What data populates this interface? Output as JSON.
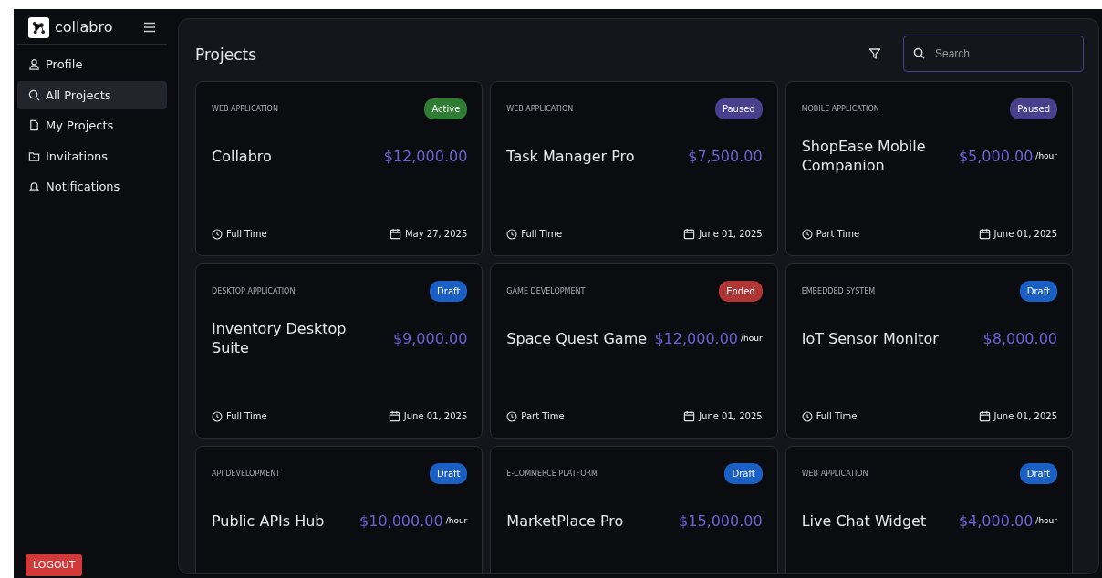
{
  "brand": {
    "name": "collabro"
  },
  "sidebar": {
    "items": [
      {
        "label": "Profile",
        "selected": false
      },
      {
        "label": "All Projects",
        "selected": true
      },
      {
        "label": "My Projects",
        "selected": false
      },
      {
        "label": "Invitations",
        "selected": false
      },
      {
        "label": "Notifications",
        "selected": false
      }
    ],
    "logout": "LOGOUT"
  },
  "header": {
    "title": "Projects",
    "search": {
      "placeholder": "Search"
    }
  },
  "projects": [
    {
      "category": "WEB APPLICATION",
      "status": "Active",
      "color": "#2e7d32",
      "name": "Collabro",
      "price": "$12,000.00",
      "type": "Full Time",
      "date": "May 27, 2025"
    },
    {
      "category": "WEB APPLICATION",
      "status": "Paused",
      "color": "#4a3f8c",
      "name": "Task Manager Pro",
      "price": "$7,500.00",
      "type": "Full Time",
      "date": "June 01, 2025"
    },
    {
      "category": "MOBILE APPLICATION",
      "status": "Paused",
      "color": "#4a3f8c",
      "name": "ShopEase Mobile Companion",
      "price": "$5,000.00",
      "unit": "/hour",
      "type": "Part Time",
      "date": "June 01, 2025"
    },
    {
      "category": "DESKTOP APPLICATION",
      "status": "Draft",
      "color": "#1a5fc4",
      "name": "Inventory Desktop Suite",
      "price": "$9,000.00",
      "type": "Full Time",
      "date": "June 01, 2025"
    },
    {
      "category": "GAME DEVELOPMENT",
      "status": "Ended",
      "color": "#b03535",
      "name": "Space Quest Game",
      "price": "$12,000.00",
      "unit": "/hour",
      "type": "Part Time",
      "date": "June 01, 2025"
    },
    {
      "category": "EMBEDDED SYSTEM",
      "status": "Draft",
      "color": "#1a5fc4",
      "name": "IoT Sensor Monitor",
      "price": "$8,000.00",
      "type": "Full Time",
      "date": "June 01, 2025"
    },
    {
      "category": "API DEVELOPMENT",
      "status": "Draft",
      "color": "#1a5fc4",
      "name": "Public APIs Hub",
      "price": "$10,000.00",
      "unit": "/hour"
    },
    {
      "category": "E-COMMERCE PLATFORM",
      "status": "Draft",
      "color": "#1a5fc4",
      "name": "MarketPlace Pro",
      "price": "$15,000.00"
    },
    {
      "category": "WEB APPLICATION",
      "status": "Draft",
      "color": "#1a5fc4",
      "name": "Live Chat Widget",
      "price": "$4,000.00",
      "unit": "/hour"
    }
  ]
}
